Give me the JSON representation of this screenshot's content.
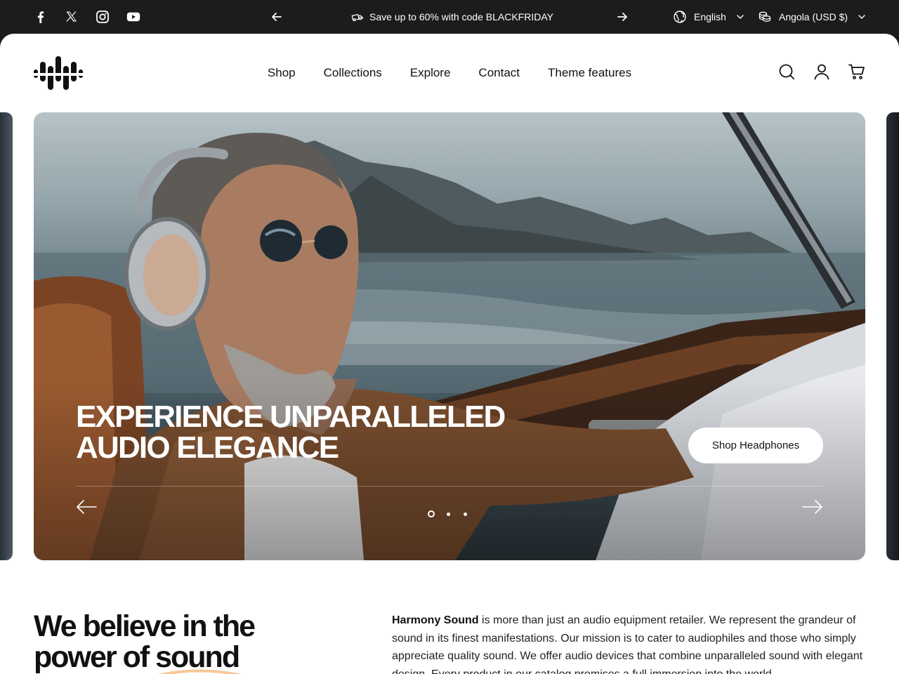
{
  "announcement": {
    "text": "Save up to 60% with code BLACKFRIDAY"
  },
  "social": [
    "facebook-icon",
    "x-icon",
    "instagram-icon",
    "youtube-icon"
  ],
  "locale": {
    "language": "English",
    "country": "Angola (USD $)"
  },
  "nav": {
    "items": [
      "Shop",
      "Collections",
      "Explore",
      "Contact",
      "Theme features"
    ]
  },
  "header_icons": [
    "search-icon",
    "account-icon",
    "cart-icon"
  ],
  "hero": {
    "title_line1": "EXPERIENCE UNPARALLELED",
    "title_line2": "AUDIO ELEGANCE",
    "button": "Shop Headphones",
    "slide_count": 3,
    "active_slide": 1
  },
  "about": {
    "title_line1": "We believe in the",
    "title_line2": "power of sound",
    "brand": "Harmony Sound",
    "body": " is more than just an audio equipment retailer. We represent the grandeur of sound in its finest manifestations. Our mission is to cater to audiophiles and those who simply appreciate quality sound. We offer audio devices that combine unparalleled sound with elegant design. Every product in our catalog promises a full immersion into the world"
  },
  "colors": {
    "topbar": "#1c1c1e",
    "page": "#ffffff",
    "accent_underline": "#f6c89a"
  }
}
